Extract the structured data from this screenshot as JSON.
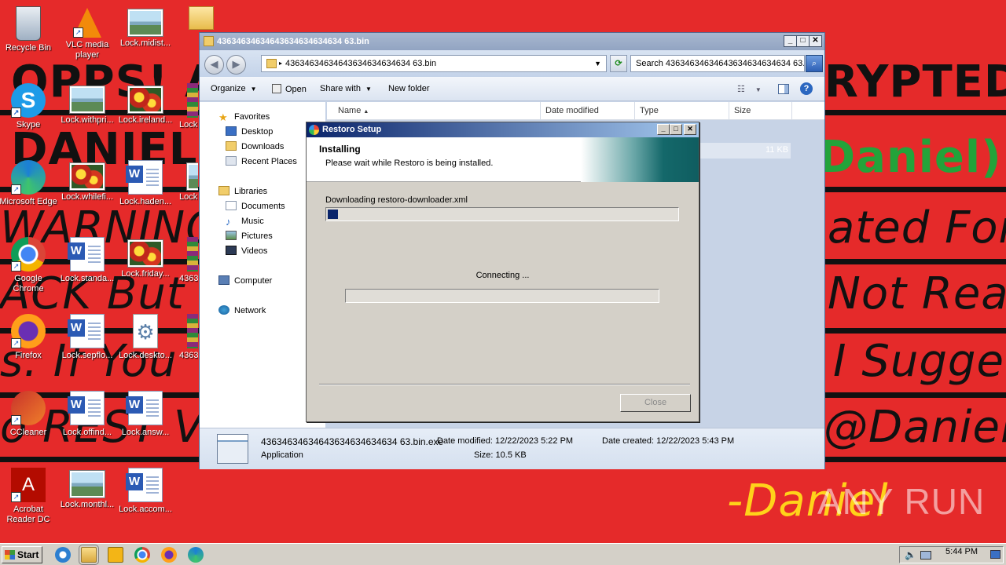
{
  "desktop": {
    "wallpaper_lines": [
      "OPPS! ALL YOUR FILES ARE ENCRYPTED BY",
      "DANIEL",
      "(Daniel)",
      "WARNING:",
      "ated For",
      "ACK But F",
      "Not Real",
      "s. If You",
      "I Sugge",
      "o REST V",
      "@Daniel",
      "-Daniel"
    ],
    "icons": [
      {
        "label": "Recycle Bin",
        "icon": "recycle-bin-icon"
      },
      {
        "label": "VLC media player",
        "icon": "vlc-icon"
      },
      {
        "label": "Lock.midist...",
        "icon": "image-file-icon"
      },
      {
        "label": "Skype",
        "icon": "skype-icon"
      },
      {
        "label": "Lock.withpri...",
        "icon": "image-file-icon"
      },
      {
        "label": "Lock.ireland...",
        "icon": "image-file-icon"
      },
      {
        "label": "Lock.",
        "icon": "archive-icon"
      },
      {
        "label": "Microsoft Edge",
        "icon": "edge-icon"
      },
      {
        "label": "Lock.whilefi...",
        "icon": "image-file-icon"
      },
      {
        "label": "Lock.haden...",
        "icon": "word-doc-icon"
      },
      {
        "label": "Lock.",
        "icon": "image-file-icon"
      },
      {
        "label": "Google Chrome",
        "icon": "chrome-icon"
      },
      {
        "label": "Lock.standa...",
        "icon": "word-doc-icon"
      },
      {
        "label": "Lock.friday...",
        "icon": "image-file-icon"
      },
      {
        "label": "4363",
        "icon": "archive-icon"
      },
      {
        "label": "Firefox",
        "icon": "firefox-icon"
      },
      {
        "label": "Lock.sepflo...",
        "icon": "word-doc-icon"
      },
      {
        "label": "Lock.deskto...",
        "icon": "settings-file-icon"
      },
      {
        "label": "4363",
        "icon": "archive-icon"
      },
      {
        "label": "CCleaner",
        "icon": "ccleaner-icon"
      },
      {
        "label": "Lock.offind...",
        "icon": "word-doc-icon"
      },
      {
        "label": "Lock.answ...",
        "icon": "word-doc-icon"
      },
      {
        "label": "Acrobat Reader DC",
        "icon": "acrobat-icon"
      },
      {
        "label": "Lock.monthl...",
        "icon": "image-file-icon"
      },
      {
        "label": "Lock.accom...",
        "icon": "word-doc-icon"
      }
    ]
  },
  "explorer": {
    "title": "43634634634643634634634634 63.bin",
    "address": "43634634634643634634634634 63.bin",
    "search_placeholder": "Search 43634634634643634634634634 63...",
    "toolbar": {
      "organize": "Organize",
      "open": "Open",
      "share_with": "Share with",
      "new_folder": "New folder"
    },
    "nav": {
      "favorites": "Favorites",
      "desktop": "Desktop",
      "downloads": "Downloads",
      "recent": "Recent Places",
      "libraries": "Libraries",
      "documents": "Documents",
      "music": "Music",
      "pictures": "Pictures",
      "videos": "Videos",
      "computer": "Computer",
      "network": "Network"
    },
    "columns": {
      "name": "Name",
      "date": "Date modified",
      "type": "Type",
      "size": "Size"
    },
    "file_size": "11 KB",
    "details": {
      "filename": "43634634634643634634634634 63.bin.exe",
      "type": "Application",
      "modified_label": "Date modified:",
      "modified": "12/22/2023 5:22 PM",
      "created_label": "Date created:",
      "created": "12/22/2023 5:43 PM",
      "size_label": "Size:",
      "size": "10.5 KB"
    }
  },
  "setup": {
    "title": "Restoro Setup",
    "heading": "Installing",
    "subheading": "Please wait while Restoro is being installed.",
    "download_status": "Downloading restoro-downloader.xml",
    "download_progress": 0.03,
    "connecting": "Connecting ...",
    "connect_progress": 0,
    "close_label": "Close"
  },
  "taskbar": {
    "start": "Start",
    "clock": "5:44 PM"
  },
  "watermark": "ANY RUN"
}
